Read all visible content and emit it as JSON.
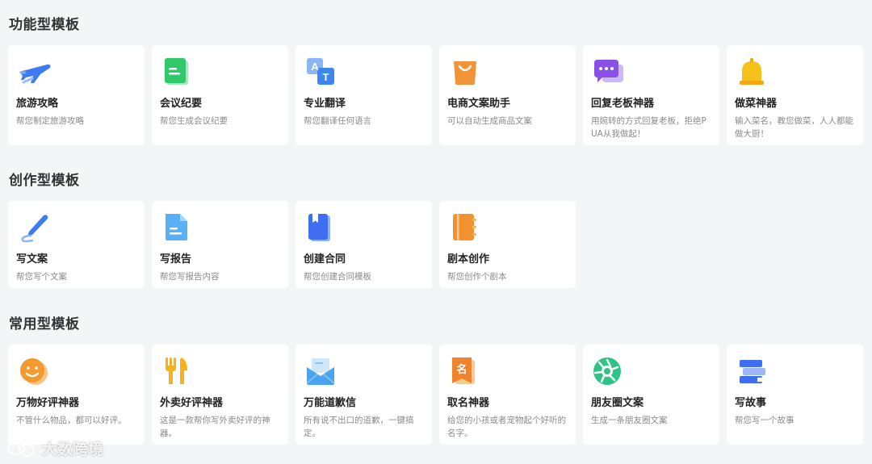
{
  "sections": [
    {
      "title": "功能型模板",
      "cards": [
        {
          "title": "旅游攻略",
          "desc": "帮您制定旅游攻略",
          "icon": "airplane-icon"
        },
        {
          "title": "会议纪要",
          "desc": "帮您生成会议纪要",
          "icon": "notes-icon"
        },
        {
          "title": "专业翻译",
          "desc": "帮您翻译任何语言",
          "icon": "translate-icon"
        },
        {
          "title": "电商文案助手",
          "desc": "可以自动生成商品文案",
          "icon": "shopping-bag-icon"
        },
        {
          "title": "回复老板神器",
          "desc": "用婉转的方式回复老板，拒绝PUA从我做起！",
          "icon": "chat-bubble-icon"
        },
        {
          "title": "做菜神器",
          "desc": "输入菜名，教您做菜，人人都能做大厨！",
          "icon": "bell-icon"
        }
      ]
    },
    {
      "title": "创作型模板",
      "cards": [
        {
          "title": "写文案",
          "desc": "帮您写个文案",
          "icon": "pen-icon"
        },
        {
          "title": "写报告",
          "desc": "帮您写报告内容",
          "icon": "document-icon"
        },
        {
          "title": "创建合同",
          "desc": "帮您创建合同模板",
          "icon": "book-icon"
        },
        {
          "title": "剧本创作",
          "desc": "帮您创作个剧本",
          "icon": "notebook-icon"
        }
      ]
    },
    {
      "title": "常用型模板",
      "cards": [
        {
          "title": "万物好评神器",
          "desc": "不管什么物品，都可以好评。",
          "icon": "smiley-icon"
        },
        {
          "title": "外卖好评神器",
          "desc": "这是一款帮你写外卖好评的神器。",
          "icon": "fork-knife-icon"
        },
        {
          "title": "万能道歉信",
          "desc": "所有说不出口的道歉，一键搞定。",
          "icon": "envelope-icon"
        },
        {
          "title": "取名神器",
          "desc": "给您的小孩或者宠物起个好听的名字。",
          "icon": "name-tag-icon"
        },
        {
          "title": "朋友圈文案",
          "desc": "生成一条朋友圈文案",
          "icon": "camera-shutter-icon"
        },
        {
          "title": "写故事",
          "desc": "帮您写一个故事",
          "icon": "books-icon"
        }
      ]
    }
  ],
  "watermark": {
    "text": "大数跨境",
    "icon": "wechat-logo-icon"
  },
  "colors": {
    "background": "#f4f5f7",
    "card": "#ffffff",
    "title": "#333333",
    "desc": "#8a8a8a"
  }
}
